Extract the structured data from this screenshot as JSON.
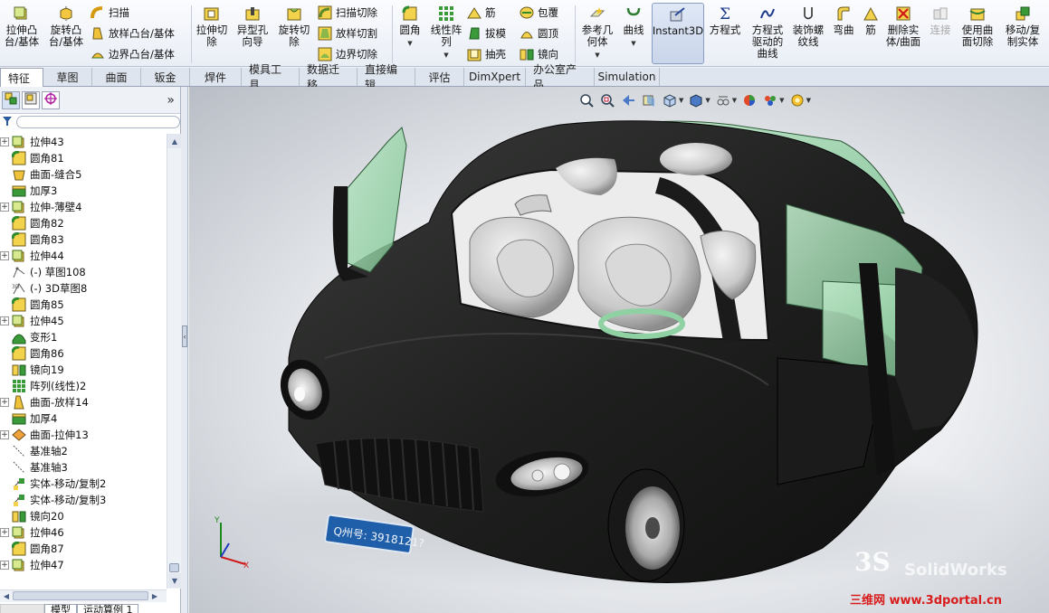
{
  "ribbon": {
    "extrude_boss": "拉伸凸\n台/基体",
    "revolve_boss": "旋转凸\n台/基体",
    "sweep": "扫描",
    "loft_boss": "放样凸台/基体",
    "boundary_boss": "边界凸台/基体",
    "extrude_cut": "拉伸切\n除",
    "hole_wizard": "异型孔\n向导",
    "revolve_cut": "旋转切\n除",
    "sweep_cut": "扫描切除",
    "loft_cut": "放样切割",
    "boundary_cut": "边界切除",
    "fillet": "圆角",
    "linear_pattern": "线性阵\n列",
    "rib": "筋",
    "draft": "拔模",
    "shell": "抽壳",
    "wrap": "包覆",
    "dome": "圆顶",
    "mirror": "镜向",
    "ref_geometry": "参考几\n何体",
    "curves": "曲线",
    "instant3d": "Instant3D",
    "equations": "方程式",
    "equation_curve": "方程式\n驱动的\n曲线",
    "cosmetic_thread": "装饰螺\n纹线",
    "flex": "弯曲",
    "rib2": "筋",
    "delete_body": "删除实\n体/曲面",
    "join": "连接",
    "use_surface_cut": "使用曲\n面切除",
    "move_copy_body": "移动/复\n制实体"
  },
  "tabs": [
    "特征",
    "草图",
    "曲面",
    "钣金",
    "焊件",
    "模具工具",
    "数据迁移",
    "直接编辑",
    "评估",
    "DimXpert",
    "办公室产品",
    "Simulation"
  ],
  "active_tab": "特征",
  "panel": {
    "collapse_label": "»",
    "tree": [
      {
        "label": "拉伸43",
        "icon": "extrude-icon",
        "expandable": true
      },
      {
        "label": "圆角81",
        "icon": "fillet-icon",
        "expandable": false
      },
      {
        "label": "曲面-缝合5",
        "icon": "knit-surface-icon",
        "expandable": false
      },
      {
        "label": "加厚3",
        "icon": "thicken-icon",
        "expandable": false
      },
      {
        "label": "拉伸-薄壁4",
        "icon": "extrude-icon",
        "expandable": true
      },
      {
        "label": "圆角82",
        "icon": "fillet-icon",
        "expandable": false
      },
      {
        "label": "圆角83",
        "icon": "fillet-icon",
        "expandable": false
      },
      {
        "label": "拉伸44",
        "icon": "extrude-icon",
        "expandable": true
      },
      {
        "label": "(-) 草图108",
        "icon": "sketch-icon",
        "expandable": false
      },
      {
        "label": "(-) 3D草图8",
        "icon": "3d-sketch-icon",
        "expandable": false
      },
      {
        "label": "圆角85",
        "icon": "fillet-icon",
        "expandable": false
      },
      {
        "label": "拉伸45",
        "icon": "extrude-icon",
        "expandable": true
      },
      {
        "label": "变形1",
        "icon": "deform-icon",
        "expandable": false
      },
      {
        "label": "圆角86",
        "icon": "fillet-icon",
        "expandable": false
      },
      {
        "label": "镜向19",
        "icon": "mirror-icon",
        "expandable": false
      },
      {
        "label": "阵列(线性)2",
        "icon": "linear-pattern-icon",
        "expandable": false
      },
      {
        "label": "曲面-放样14",
        "icon": "loft-surface-icon",
        "expandable": true
      },
      {
        "label": "加厚4",
        "icon": "thicken-icon",
        "expandable": false
      },
      {
        "label": "曲面-拉伸13",
        "icon": "extrude-surface-icon",
        "expandable": true
      },
      {
        "label": "基准轴2",
        "icon": "axis-icon",
        "expandable": false
      },
      {
        "label": "基准轴3",
        "icon": "axis-icon",
        "expandable": false
      },
      {
        "label": "实体-移动/复制2",
        "icon": "move-copy-icon",
        "expandable": false
      },
      {
        "label": "实体-移动/复制3",
        "icon": "move-copy-icon",
        "expandable": false
      },
      {
        "label": "镜向20",
        "icon": "mirror-icon",
        "expandable": false
      },
      {
        "label": "拉伸46",
        "icon": "extrude-icon",
        "expandable": true
      },
      {
        "label": "圆角87",
        "icon": "fillet-icon",
        "expandable": false
      },
      {
        "label": "拉伸47",
        "icon": "extrude-icon",
        "expandable": true
      }
    ],
    "bottom_tabs": [
      "模型",
      "运动算例 1"
    ]
  },
  "viewport": {
    "license_plate": "Q州号: 3918121?",
    "watermark": "三维网 www.3dportal.cn",
    "logo_text": "SolidWorks",
    "car_body_color": "#1c1d1c",
    "glass_color": "#8fd1a3",
    "seat_color": "#d3d3d3",
    "plate_color": "#1f5ea8"
  },
  "colors": {
    "ribbon_bg": "#e9eef6",
    "accent_active": "#c9d5ea"
  }
}
